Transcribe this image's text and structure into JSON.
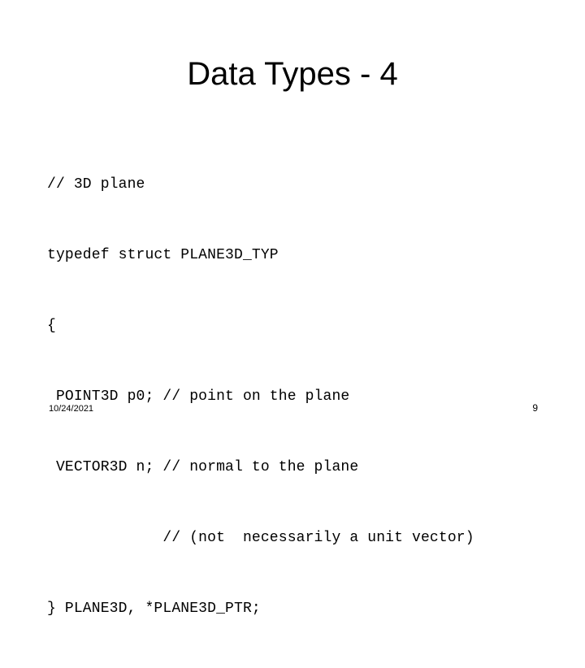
{
  "slide": {
    "title": "Data Types - 4",
    "background_color": "#ffffff",
    "text_color": "#000000",
    "code_lines": [
      "// 3D plane",
      "typedef struct PLANE3D_TYP",
      "{",
      " POINT3D p0; // point on the plane",
      " VECTOR3D n; // normal to the plane",
      "             // (not  necessarily a unit vector)",
      "} PLANE3D, *PLANE3D_PTR;"
    ],
    "footer": {
      "date": "10/24/2021",
      "page_number": "9"
    }
  }
}
